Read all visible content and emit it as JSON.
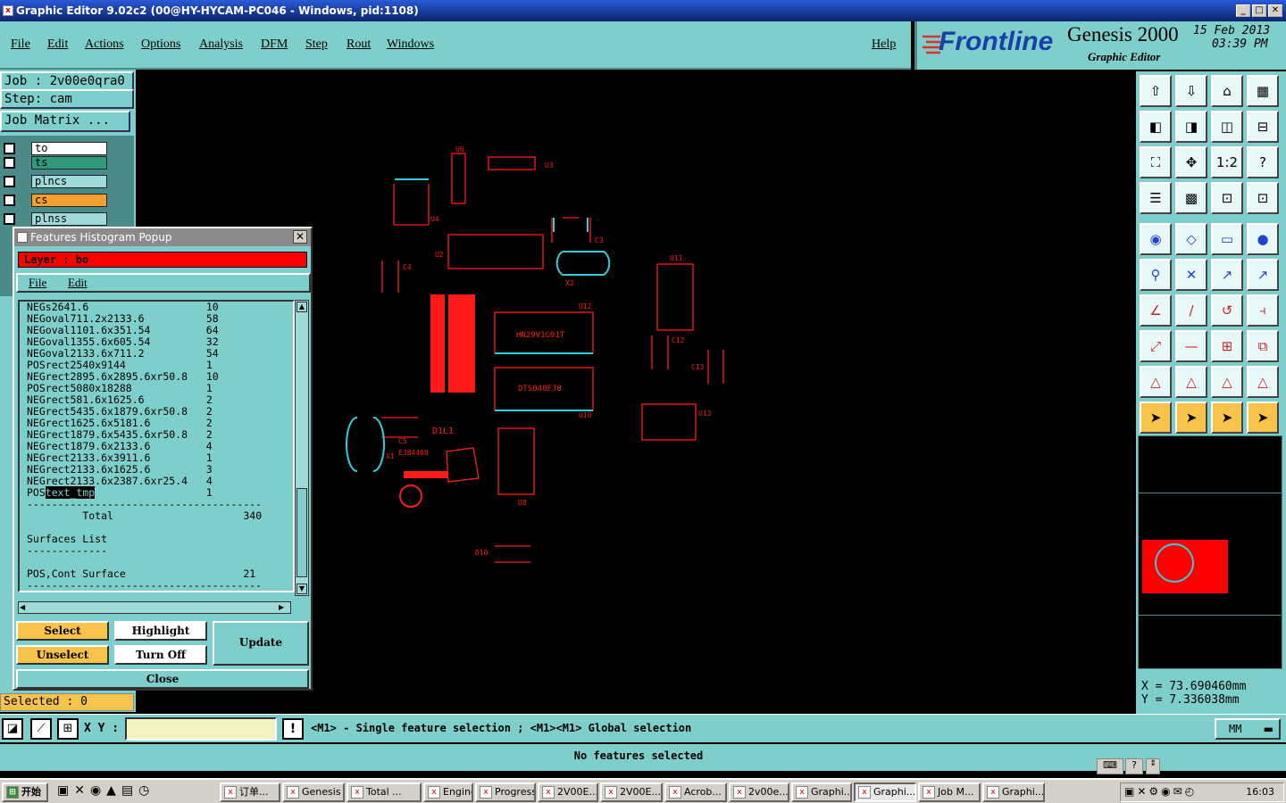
{
  "window": {
    "title": "Graphic Editor 9.02c2 (00@HY-HYCAM-PC046 - Windows, pid:1108)"
  },
  "menu": {
    "items": [
      "File",
      "Edit",
      "Actions",
      "Options",
      "Analysis",
      "DFM",
      "Step",
      "Rout",
      "Windows"
    ],
    "help": "Help"
  },
  "brand": {
    "logo": "Frontline",
    "product": "Genesis 2000",
    "subtitle": "Graphic Editor",
    "date": "15 Feb 2013",
    "time": "03:39 PM"
  },
  "job": {
    "job_label": "Job : 2v00e0qra0",
    "step_label": "Step: cam",
    "matrix_button": "Job Matrix ..."
  },
  "layers": [
    {
      "name": "to",
      "color": "#ffffff"
    },
    {
      "name": "ts",
      "color": "#2f9a7a"
    },
    {
      "name": "plncs",
      "color": "#9edbd8"
    },
    {
      "name": "cs",
      "color": "#f7a030"
    },
    {
      "name": "plnss",
      "color": "#9edbd8"
    }
  ],
  "popup": {
    "title": "Features Histogram Popup",
    "layer_label": "Layer :  bo",
    "menu": [
      "File",
      "Edit"
    ],
    "rows": [
      {
        "pol": "NEG",
        "sym": "s2641.6",
        "count": "10"
      },
      {
        "pol": "NEG",
        "sym": "oval711.2x2133.6",
        "count": "58"
      },
      {
        "pol": "NEG",
        "sym": "oval1101.6x351.54",
        "count": "64"
      },
      {
        "pol": "NEG",
        "sym": "oval1355.6x605.54",
        "count": "32"
      },
      {
        "pol": "NEG",
        "sym": "oval2133.6x711.2",
        "count": "54"
      },
      {
        "pol": "POS",
        "sym": "rect2540x9144",
        "count": "1"
      },
      {
        "pol": "NEG",
        "sym": "rect2895.6x2895.6xr50.8",
        "count": "10"
      },
      {
        "pol": "POS",
        "sym": "rect5080x18288",
        "count": "1"
      },
      {
        "pol": "NEG",
        "sym": "rect581.6x1625.6",
        "count": "2"
      },
      {
        "pol": "NEG",
        "sym": "rect5435.6x1879.6xr50.8",
        "count": "2"
      },
      {
        "pol": "NEG",
        "sym": "rect1625.6x5181.6",
        "count": "2"
      },
      {
        "pol": "NEG",
        "sym": "rect1879.6x5435.6xr50.8",
        "count": "2"
      },
      {
        "pol": "NEG",
        "sym": "rect1879.6x2133.6",
        "count": "4"
      },
      {
        "pol": "NEG",
        "sym": "rect2133.6x3911.6",
        "count": "1"
      },
      {
        "pol": "NEG",
        "sym": "rect2133.6x1625.6",
        "count": "3"
      },
      {
        "pol": "NEG",
        "sym": "rect2133.6x2387.6xr25.4",
        "count": "4"
      },
      {
        "pol": "POS",
        "sym": "text_tmp",
        "count": "1"
      }
    ],
    "total_label": "Total",
    "total_value": "340",
    "surfaces_label": "Surfaces List",
    "surface_row": {
      "label": "POS,Cont Surface",
      "value": "21"
    },
    "buttons": {
      "select": "Select",
      "highlight": "Highlight",
      "update": "Update",
      "unselect": "Unselect",
      "turn_off": "Turn Off",
      "close": "Close"
    }
  },
  "selected": "Selected : 0",
  "coords": {
    "x": "X  =  73.690460mm",
    "y": "Y  =  7.336038mm"
  },
  "status": {
    "xy_label": "X Y :",
    "xy_value": "",
    "hint": "<M1> - Single feature selection ; <M1><M1> Global selection",
    "units": "MM"
  },
  "message": "No features selected",
  "canvas_labels": {
    "u6": "U6",
    "u3": "U3",
    "u4": "U4",
    "u2": "U2",
    "c4": "C4",
    "c3": "C3",
    "x2": "X2",
    "u11": "U11",
    "u12": "U12",
    "c12": "C12",
    "c13": "C13",
    "u10": "U10",
    "u13": "U13",
    "u8": "U8",
    "x1": "X1",
    "c5": "C5",
    "d10": "D10",
    "chip1": "HN29V1G91T",
    "chip2": "DTS040FJ8",
    "mark": "D1L1",
    "part": "E384468"
  },
  "taskbar": {
    "start": "开始",
    "tasks": [
      "订单...",
      "Genesis",
      "Total ...",
      "Engine...",
      "Progress",
      "2V00E...",
      "2V00E...",
      "Acrob...",
      "2v00e...",
      "Graphi...",
      "Graphi...",
      "Job M...",
      "Graphi..."
    ],
    "clock": "16:03"
  }
}
